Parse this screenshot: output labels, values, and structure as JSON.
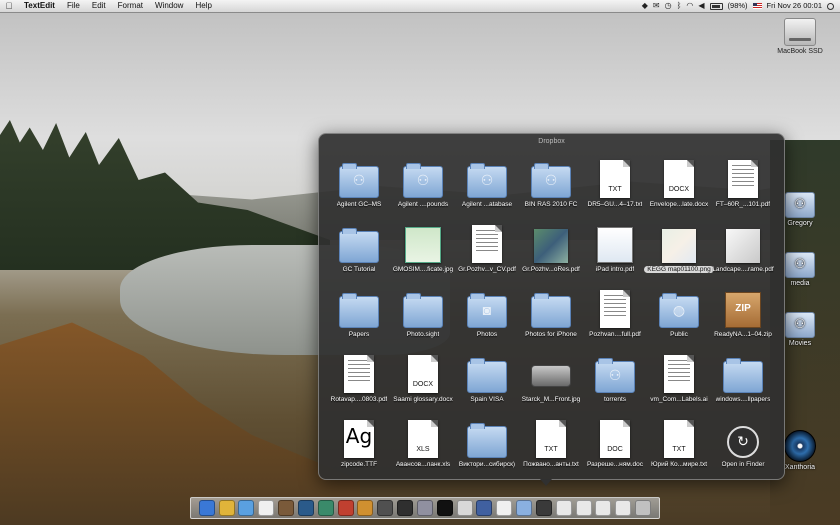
{
  "menubar": {
    "apple_icon": "apple-icon",
    "app_name": "TextEdit",
    "items": [
      "File",
      "Edit",
      "Format",
      "Window",
      "Help"
    ],
    "battery_text": "(98%)",
    "clock": "Fri Nov 26  00:01"
  },
  "desktop": {
    "hdd_label": "MacBook SSD",
    "shared": [
      {
        "label": "Gregory"
      },
      {
        "label": "media"
      },
      {
        "label": "Movies"
      }
    ],
    "disc_label": "Xanthoria"
  },
  "stack": {
    "title": "Dropbox",
    "items": [
      {
        "label": "Agilent GC–MS",
        "kind": "folder",
        "glyph": "⚇"
      },
      {
        "label": "Agilent ....pounds",
        "kind": "folder",
        "glyph": "⚇"
      },
      {
        "label": "Agilent ...atabase",
        "kind": "folder",
        "glyph": "⚇"
      },
      {
        "label": "BIN RAS 2010 FC",
        "kind": "folder",
        "glyph": "⚇"
      },
      {
        "label": "DR5–GU...4–17.txt",
        "kind": "doc",
        "ext": "TXT"
      },
      {
        "label": "Envelope...late.docx",
        "kind": "doc",
        "ext": "DOCX"
      },
      {
        "label": "FT–60R_...101.pdf",
        "kind": "pdf"
      },
      {
        "label": "GC Tutorial",
        "kind": "folder",
        "glyph": ""
      },
      {
        "label": "GMOSIM....ficate.jpg",
        "kind": "img",
        "style": "cert"
      },
      {
        "label": "Gr.Pozhv...v_CV.pdf",
        "kind": "pdf"
      },
      {
        "label": "Gr.Pozhv...oRes.pdf",
        "kind": "img",
        "style": "photo"
      },
      {
        "label": "iPad intro.pdf",
        "kind": "img",
        "style": "ipad"
      },
      {
        "label": "KEGG map01100.png",
        "kind": "img",
        "style": "map",
        "selected": true
      },
      {
        "label": "Landcape....rame.pdf",
        "kind": "img",
        "style": "gray"
      },
      {
        "label": "Papers",
        "kind": "folder",
        "glyph": ""
      },
      {
        "label": "Photo.sight",
        "kind": "folder",
        "glyph": ""
      },
      {
        "label": "Photos",
        "kind": "folder",
        "glyph": "◙"
      },
      {
        "label": "Photos for iPhone",
        "kind": "folder",
        "glyph": ""
      },
      {
        "label": "Pozhvan....full.pdf",
        "kind": "pdf"
      },
      {
        "label": "Public",
        "kind": "folder",
        "glyph": "◍"
      },
      {
        "label": "ReadyNA...1–04.zip",
        "kind": "zip",
        "ext": "ZIP"
      },
      {
        "label": "Rotavap....0803.pdf",
        "kind": "pdf"
      },
      {
        "label": "Saami glossary.docx",
        "kind": "doc",
        "ext": "DOCX"
      },
      {
        "label": "Spain VISA",
        "kind": "folder",
        "glyph": ""
      },
      {
        "label": "Starck_M...Front.jpg",
        "kind": "drive"
      },
      {
        "label": "torrents",
        "kind": "folder",
        "glyph": "⚇"
      },
      {
        "label": "vm_Com...Labels.ai",
        "kind": "pdf"
      },
      {
        "label": "windows....llpapers",
        "kind": "folder",
        "glyph": ""
      },
      {
        "label": "zipcode.TTF",
        "kind": "font",
        "big": "Ag"
      },
      {
        "label": "Авансов...ланк.xls",
        "kind": "doc",
        "ext": "XLS"
      },
      {
        "label": "Виктори...сибирск)",
        "kind": "folder",
        "glyph": ""
      },
      {
        "label": "Пожвано...анты.txt",
        "kind": "doc",
        "ext": "TXT"
      },
      {
        "label": "Разреше...ням.doc",
        "kind": "doc",
        "ext": "DOC"
      },
      {
        "label": "Юрий Ко...мире.txt",
        "kind": "doc",
        "ext": "TXT"
      },
      {
        "label": "Open in Finder",
        "kind": "finder"
      }
    ]
  },
  "dock": {
    "icons": [
      {
        "name": "finder-icon",
        "color": "#3a78d6"
      },
      {
        "name": "chrome-icon",
        "color": "#e0b43a"
      },
      {
        "name": "itunes-icon",
        "color": "#5aa0e0"
      },
      {
        "name": "ical-icon",
        "color": "#f0f0f0"
      },
      {
        "name": "app-icon",
        "color": "#7a5a3a"
      },
      {
        "name": "photoshop-icon",
        "color": "#2a5a8a"
      },
      {
        "name": "app-icon",
        "color": "#3a8a6a"
      },
      {
        "name": "app-icon",
        "color": "#c04030"
      },
      {
        "name": "app-icon",
        "color": "#d09030"
      },
      {
        "name": "app-icon",
        "color": "#505050"
      },
      {
        "name": "app-icon",
        "color": "#2f2f2f"
      },
      {
        "name": "app-icon",
        "color": "#9090a0"
      },
      {
        "name": "terminal-icon",
        "color": "#111111"
      },
      {
        "name": "app-icon",
        "color": "#d8d8d8"
      },
      {
        "name": "app-icon",
        "color": "#4060a0"
      },
      {
        "name": "document-icon",
        "color": "#f0f0f0"
      },
      {
        "name": "dropbox-stack-icon",
        "color": "#8ab0e0"
      },
      {
        "name": "app-icon",
        "color": "#3a3a3a"
      },
      {
        "name": "stack-icon",
        "color": "#e8e8e8"
      },
      {
        "name": "app-icon",
        "color": "#e8e8e8"
      },
      {
        "name": "app-icon",
        "color": "#e8e8e8"
      },
      {
        "name": "app-icon",
        "color": "#e8e8e8"
      },
      {
        "name": "trash-icon",
        "color": "#c0c0c0"
      }
    ]
  }
}
